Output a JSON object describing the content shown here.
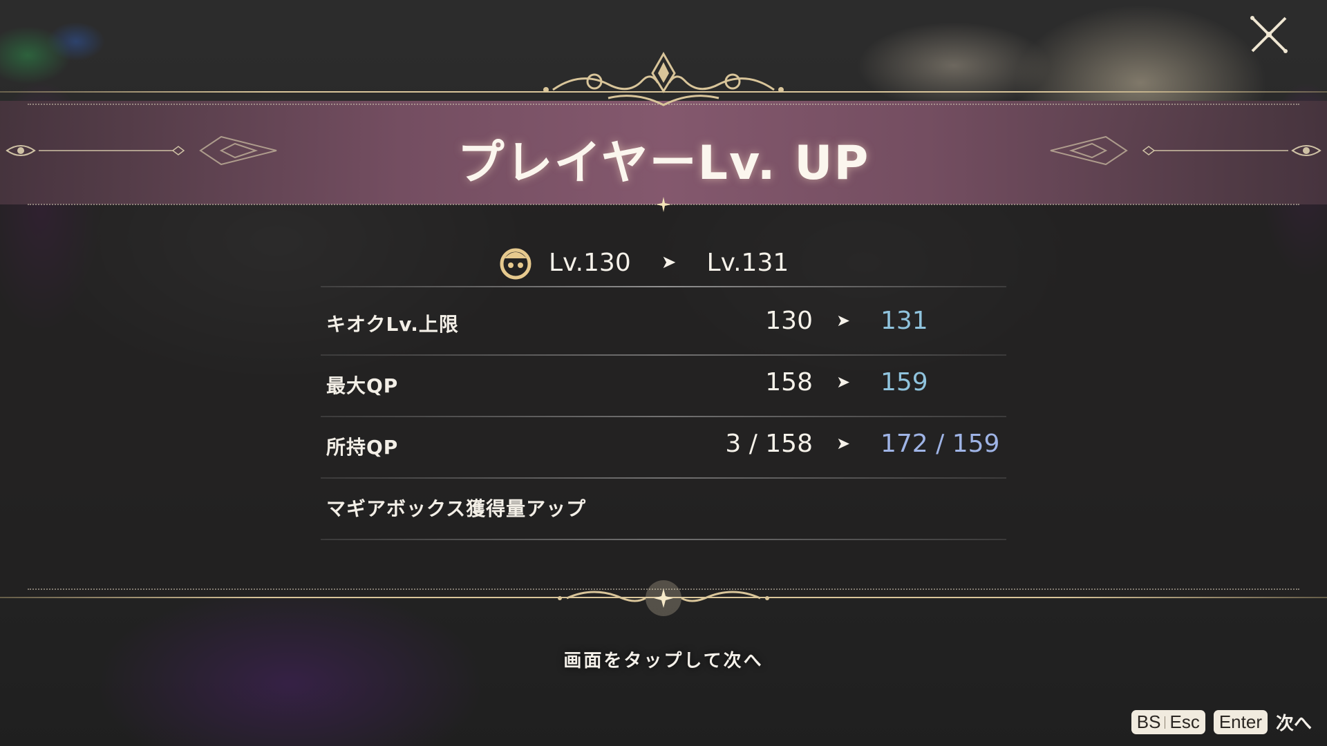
{
  "title": "プレイヤーLv. UP",
  "level": {
    "from": "Lv.130",
    "to": "Lv.131"
  },
  "rows": [
    {
      "label": "キオクLv.上限",
      "old": "130",
      "new": "131"
    },
    {
      "label": "最大QP",
      "old": "158",
      "new": "159"
    },
    {
      "label": "所持QP",
      "old": "3 / 158",
      "new": "172 / 159"
    },
    {
      "label": "マギアボックス獲得量アップ",
      "old": "",
      "new": ""
    }
  ],
  "arrow": "➤",
  "tap_hint": "画面をタップして次へ",
  "keys": {
    "bs": "BS",
    "esc": "Esc",
    "enter": "Enter",
    "next_label": "次へ"
  },
  "icons": {
    "close": "close-icon",
    "player": "player-face-icon"
  },
  "colors": {
    "accent_gold": "#d9c59a",
    "new_value": "#8fc3dd",
    "title_band": "#87596f"
  }
}
